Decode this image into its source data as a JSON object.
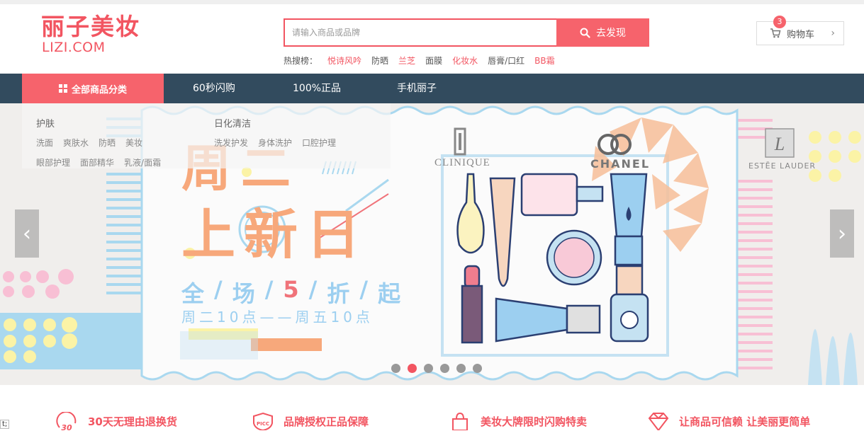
{
  "logo": {
    "cn": "丽子美妆",
    "en": "LIZI.COM"
  },
  "search": {
    "placeholder": "请输入商品或品牌",
    "button_label": "去发现"
  },
  "hot": {
    "label": "热搜榜：",
    "items": [
      {
        "text": "悦诗风吟",
        "highlight": true
      },
      {
        "text": "防晒",
        "highlight": false
      },
      {
        "text": "兰芝",
        "highlight": true
      },
      {
        "text": "面膜",
        "highlight": false
      },
      {
        "text": "化妆水",
        "highlight": true
      },
      {
        "text": "唇膏/口红",
        "highlight": false
      },
      {
        "text": "BB霜",
        "highlight": true
      }
    ]
  },
  "cart": {
    "label": "购物车",
    "count": "3"
  },
  "nav": {
    "all_label": "全部商品分类",
    "items": [
      "60秒闪购",
      "100%正品",
      "手机丽子"
    ]
  },
  "categories": {
    "skincare": {
      "title": "护肤",
      "row1": [
        "洗面",
        "爽肤水",
        "防晒",
        "美妆"
      ],
      "row2": [
        "眼部护理",
        "面部精华",
        "乳液/面霜"
      ]
    },
    "cleaning": {
      "title": "日化清洁",
      "row1": [
        "洗发护发",
        "身体洗护",
        "口腔护理"
      ]
    }
  },
  "banner": {
    "line1": "周二",
    "line2": "上新日",
    "line3": [
      "全",
      "场",
      "5",
      "折",
      "起"
    ],
    "line4": "周二10点——周五10点",
    "brands": [
      "CLINIQUE",
      "CHANEL",
      "ESTĒE LAUDER"
    ],
    "slides": 6,
    "active_slide": 1
  },
  "features": [
    {
      "icon": "30-day-return-icon",
      "badge": "30",
      "text": "30天无理由退换货"
    },
    {
      "icon": "picc-shield-icon",
      "badge": "PICC",
      "text": "品牌授权正品保障"
    },
    {
      "icon": "shopping-bag-icon",
      "badge": "",
      "text": "美妆大牌限时闪购特卖"
    },
    {
      "icon": "diamond-icon",
      "badge": "",
      "text": "让商品可信赖 让美丽更简单"
    }
  ],
  "colors": {
    "brand": "#f25561",
    "nav_bg": "#324b5e",
    "button": "#f6636c"
  },
  "edge_text": "t;"
}
